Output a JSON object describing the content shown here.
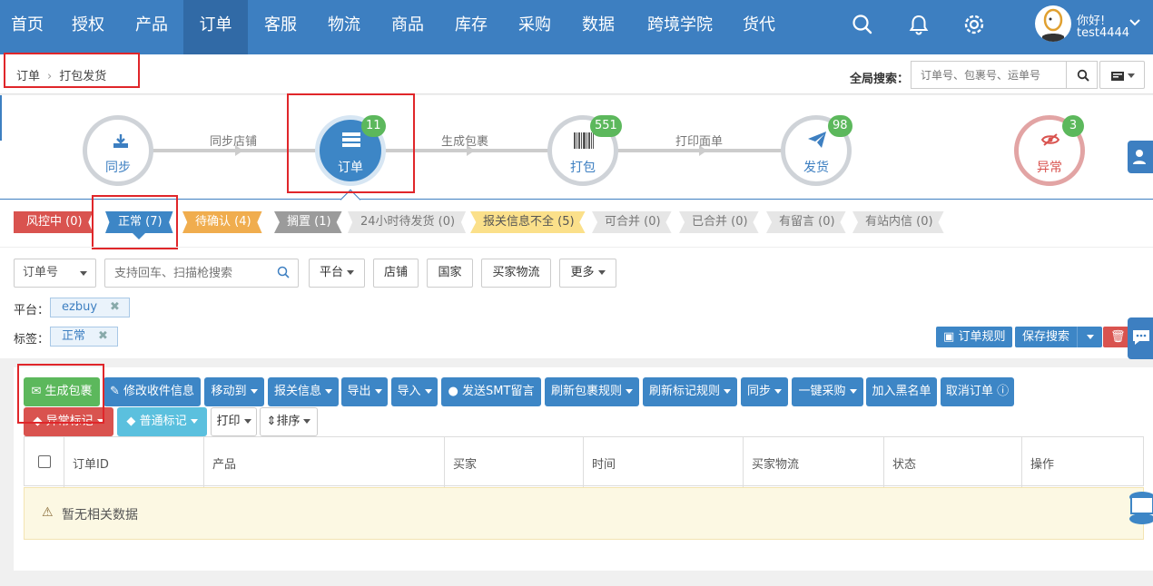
{
  "nav": {
    "items": [
      "首页",
      "授权",
      "产品",
      "订单",
      "客服",
      "物流",
      "商品",
      "库存",
      "采购",
      "数据",
      "跨境学院",
      "货代"
    ],
    "active_index": 3,
    "user": {
      "greeting": "你好!",
      "username": "test4444"
    }
  },
  "breadcrumb": {
    "root": "订单",
    "current": "打包发货"
  },
  "global_search": {
    "label": "全局搜索：",
    "placeholder": "订单号、包裹号、运单号"
  },
  "flow": {
    "steps": [
      {
        "label": "同步",
        "icon": "download-icon"
      },
      {
        "label": "订单",
        "icon": "list-icon",
        "badge": "11"
      },
      {
        "label": "打包",
        "icon": "barcode-icon",
        "badge": "551"
      },
      {
        "label": "发货",
        "icon": "paper-plane-icon",
        "badge": "98"
      },
      {
        "label": "异常",
        "icon": "eye-slash-icon",
        "badge": "3"
      }
    ],
    "connectors": [
      "同步店铺",
      "生成包裹",
      "打印面单"
    ]
  },
  "status_tabs": [
    {
      "label": "风控中 (0)",
      "color": "#d9534f"
    },
    {
      "label": "正常 (7)",
      "color": "#3d86c6"
    },
    {
      "label": "待确认 (4)",
      "color": "#f0ad4e"
    },
    {
      "label": "搁置 (1)",
      "color": "#999999"
    },
    {
      "label": "24小时待发货 (0)",
      "color": "#e6e6e6"
    },
    {
      "label": "报关信息不全 (5)",
      "color": "#fbe08a"
    },
    {
      "label": "可合并 (0)",
      "color": "#e6e6e6"
    },
    {
      "label": "已合并 (0)",
      "color": "#e6e6e6"
    },
    {
      "label": "有留言 (0)",
      "color": "#e6e6e6"
    },
    {
      "label": "有站内信 (0)",
      "color": "#e6e6e6"
    }
  ],
  "filters": {
    "field_select": "订单号",
    "search_placeholder": "支持回车、扫描枪搜索",
    "platform": "平台",
    "shop": "店铺",
    "country": "国家",
    "buyer_logistics": "买家物流",
    "more": "更多"
  },
  "chips": {
    "platform_label": "平台：",
    "platform_value": "ezbuy",
    "tag_label": "标签：",
    "tag_value": "正常",
    "remove_glyph": "✖"
  },
  "right_buttons": {
    "order_rules": "订单规则",
    "save_search": "保存搜索"
  },
  "actions": {
    "generate_package": "生成包裹",
    "edit_receiver": "修改收件信息",
    "move_to": "移动到",
    "customs_info": "报关信息",
    "export": "导出",
    "import": "导入",
    "send_smt": "发送SMT留言",
    "refresh_package_rules": "刷新包裹规则",
    "refresh_tag_rules": "刷新标记规则",
    "sync": "同步",
    "one_click_purchase": "一键采购",
    "add_blacklist": "加入黑名单",
    "cancel_order": "取消订单",
    "abnormal_tag": "异常标记",
    "normal_tag": "普通标记",
    "print": "打印",
    "sort": "排序"
  },
  "table": {
    "columns": [
      "订单ID",
      "产品",
      "买家",
      "时间",
      "买家物流",
      "状态",
      "操作"
    ],
    "empty_text": "暂无相关数据"
  },
  "colors": {
    "primary": "#3d7fc1",
    "success": "#5cb85c",
    "danger": "#d9534f",
    "warning": "#f0ad4e",
    "highlight": "#e0262a"
  }
}
